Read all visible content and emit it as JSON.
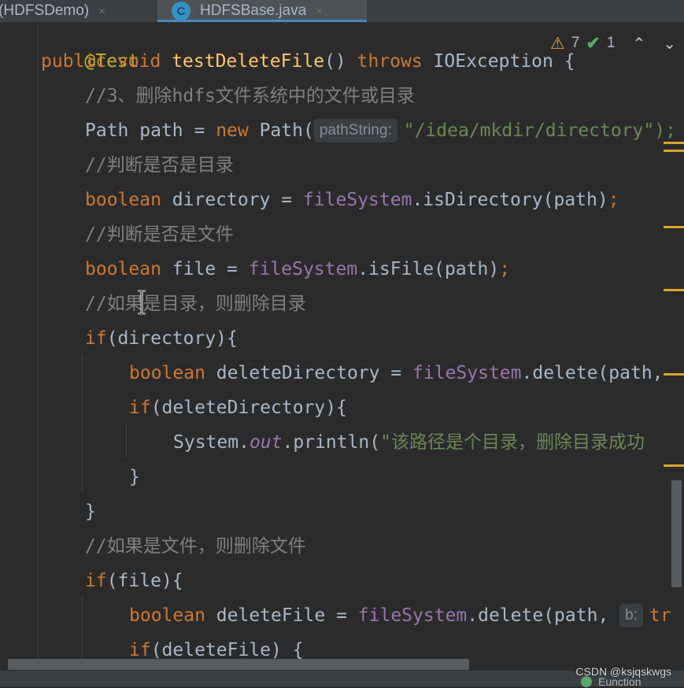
{
  "tabs": [
    {
      "label": "hi (HDFSDemo)",
      "close": "×"
    },
    {
      "label": "HDFSBase.java",
      "close": "×",
      "icon": "C",
      "active": true
    }
  ],
  "inspection": {
    "warnings": "7",
    "checks": "1"
  },
  "code": {
    "annotation": "@Test",
    "l1": {
      "kw1": "public ",
      "kw2": "void ",
      "name": "testDeleteFile",
      "p": "() ",
      "kw3": "throws ",
      "exc": "IOException {"
    },
    "c1": "//3、删除hdfs文件系统中的文件或目录",
    "l2": {
      "type": "Path ",
      "var": "path = ",
      "kw": "new ",
      "ctor": "Path(",
      "hint": "pathString:",
      "str": "\"/idea/mkdir/directory\");"
    },
    "c2": "//判断是否是目录",
    "l3": {
      "kw": "boolean ",
      "var": "directory = ",
      "fld": "fileSystem",
      "rest": ".isDirectory(path)",
      "semi": ";"
    },
    "c3": "//判断是否是文件",
    "l4": {
      "kw": "boolean ",
      "var": "file = ",
      "fld": "fileSystem",
      "rest": ".isFile(path)",
      "semi": ";"
    },
    "c4": "//如果是目录，则删除目录",
    "l5": {
      "kw": "if",
      "rest": "(directory){"
    },
    "l6": {
      "kw": "boolean ",
      "var": "deleteDirectory = ",
      "fld": "fileSystem",
      "rest": ".delete(path,"
    },
    "l7": {
      "kw": "if",
      "rest": "(deleteDirectory){"
    },
    "l8": {
      "cls": "System.",
      "stat": "out",
      "rest": ".println(",
      "str": "\"该路径是个目录，删除目录成功"
    },
    "l9": "}",
    "l10": "}",
    "c5": "//如果是文件，则删除文件",
    "l11": {
      "kw": "if",
      "rest": "(file){"
    },
    "l12": {
      "kw": "boolean ",
      "var": "deleteFile = ",
      "fld": "fileSystem",
      "rest": ".delete(path, ",
      "hint": "b:",
      "tail": "tr"
    },
    "l13": {
      "kw": "if",
      "rest": "(deleteFile) {"
    }
  },
  "status": {
    "item": "Eunction"
  },
  "watermark": "CSDN @ksjqskwgs"
}
